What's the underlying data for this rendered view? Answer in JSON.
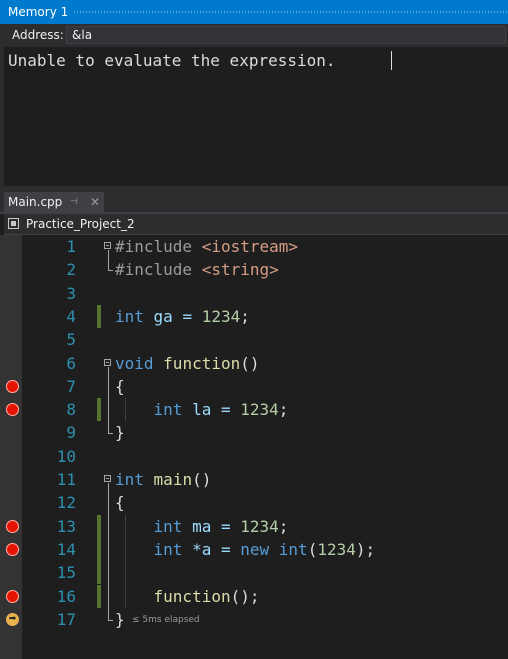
{
  "memory_window": {
    "title": "Memory 1",
    "address_label": "Address:",
    "address_value": "&la",
    "message": "Unable to evaluate the expression."
  },
  "tabs": [
    {
      "label": "Main.cpp",
      "pinned": true,
      "active": true
    }
  ],
  "navbar": {
    "project": "Practice_Project_2"
  },
  "editor": {
    "lines": [
      {
        "n": "1",
        "tokens": [
          {
            "t": "#include ",
            "c": "inc"
          },
          {
            "t": "<iostream>",
            "c": "str"
          }
        ]
      },
      {
        "n": "2",
        "tokens": [
          {
            "t": "#include ",
            "c": "inc"
          },
          {
            "t": "<string>",
            "c": "str"
          }
        ]
      },
      {
        "n": "3",
        "tokens": []
      },
      {
        "n": "4",
        "tokens": [
          {
            "t": "int",
            "c": "kw"
          },
          {
            "t": " ga = ",
            "c": "id"
          },
          {
            "t": "1234",
            "c": "num"
          },
          {
            "t": ";",
            "c": ""
          }
        ]
      },
      {
        "n": "5",
        "tokens": []
      },
      {
        "n": "6",
        "tokens": [
          {
            "t": "void",
            "c": "kw"
          },
          {
            "t": " ",
            "c": ""
          },
          {
            "t": "function",
            "c": "fn"
          },
          {
            "t": "()",
            "c": ""
          }
        ]
      },
      {
        "n": "7",
        "tokens": [
          {
            "t": "{",
            "c": ""
          }
        ]
      },
      {
        "n": "8",
        "tokens": [
          {
            "t": "    ",
            "c": ""
          },
          {
            "t": "int",
            "c": "kw"
          },
          {
            "t": " la = ",
            "c": "id"
          },
          {
            "t": "1234",
            "c": "num"
          },
          {
            "t": ";",
            "c": ""
          }
        ]
      },
      {
        "n": "9",
        "tokens": [
          {
            "t": "}",
            "c": ""
          }
        ]
      },
      {
        "n": "10",
        "tokens": []
      },
      {
        "n": "11",
        "tokens": [
          {
            "t": "int",
            "c": "kw"
          },
          {
            "t": " ",
            "c": ""
          },
          {
            "t": "main",
            "c": "fn"
          },
          {
            "t": "()",
            "c": ""
          }
        ]
      },
      {
        "n": "12",
        "tokens": [
          {
            "t": "{",
            "c": ""
          }
        ]
      },
      {
        "n": "13",
        "tokens": [
          {
            "t": "    ",
            "c": ""
          },
          {
            "t": "int",
            "c": "kw"
          },
          {
            "t": " ma = ",
            "c": "id"
          },
          {
            "t": "1234",
            "c": "num"
          },
          {
            "t": ";",
            "c": ""
          }
        ]
      },
      {
        "n": "14",
        "tokens": [
          {
            "t": "    ",
            "c": ""
          },
          {
            "t": "int",
            "c": "kw"
          },
          {
            "t": " *a = ",
            "c": "id"
          },
          {
            "t": "new",
            "c": "kw"
          },
          {
            "t": " ",
            "c": ""
          },
          {
            "t": "int",
            "c": "kw"
          },
          {
            "t": "(",
            "c": ""
          },
          {
            "t": "1234",
            "c": "num"
          },
          {
            "t": ");",
            "c": ""
          }
        ]
      },
      {
        "n": "15",
        "tokens": []
      },
      {
        "n": "16",
        "tokens": [
          {
            "t": "    ",
            "c": ""
          },
          {
            "t": "function",
            "c": "fn"
          },
          {
            "t": "();",
            "c": ""
          }
        ]
      },
      {
        "n": "17",
        "tokens": [
          {
            "t": "}",
            "c": ""
          }
        ]
      }
    ],
    "breakpoint_lines": [
      7,
      8,
      13,
      14,
      16
    ],
    "current_line": 17,
    "changed_lines": [
      4,
      8,
      13,
      14,
      15,
      16
    ],
    "fold_start_lines": [
      1,
      6,
      11
    ],
    "perf_tip": "≤ 5ms elapsed"
  },
  "colors": {
    "accent": "#007acc",
    "keyword": "#569cd6",
    "line_number": "#2b91af",
    "breakpoint": "#e51400",
    "number": "#b5cea8"
  },
  "icons": [
    "pin-icon",
    "close-icon",
    "project-icon",
    "breakpoint-icon",
    "execution-arrow-icon",
    "fold-toggle-icon"
  ]
}
